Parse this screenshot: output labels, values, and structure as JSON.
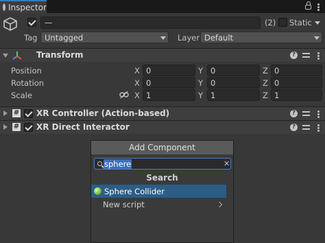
{
  "tab": {
    "title": "Inspector"
  },
  "object": {
    "name_value": "—",
    "count": "(2)",
    "static_label": "Static",
    "tag_label": "Tag",
    "tag_value": "Untagged",
    "layer_label": "Layer",
    "layer_value": "Default"
  },
  "transform": {
    "title": "Transform",
    "rows": [
      {
        "label": "Position",
        "x": "0",
        "y": "0",
        "z": "0"
      },
      {
        "label": "Rotation",
        "x": "0",
        "y": "0",
        "z": "0"
      },
      {
        "label": "Scale",
        "x": "1",
        "y": "1",
        "z": "1"
      }
    ],
    "axes": {
      "x": "X",
      "y": "Y",
      "z": "Z"
    }
  },
  "components": [
    {
      "title": "XR Controller (Action-based)",
      "enabled": true
    },
    {
      "title": "XR Direct Interactor",
      "enabled": true
    }
  ],
  "popup": {
    "title": "Add Component",
    "search_value": "sphere",
    "section_title": "Search",
    "items": [
      {
        "label": "Sphere Collider",
        "icon": "sphere-collider-icon",
        "selected": true
      },
      {
        "label": "New script",
        "has_submenu": true
      }
    ]
  },
  "help_glyph": "?",
  "hash_glyph": "#",
  "clear_glyph": "✕",
  "colors": {
    "accent": "#3a79bb",
    "selection": "#2c5d87",
    "background": "#383838"
  }
}
